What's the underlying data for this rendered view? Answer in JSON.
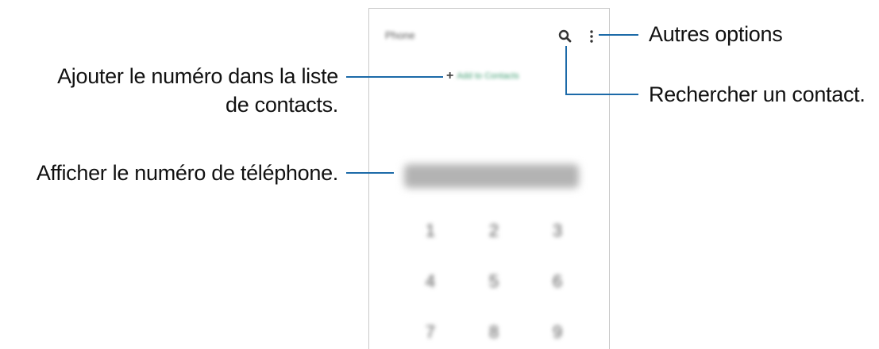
{
  "labels": {
    "more_options": "Autres options",
    "add_contact_line1": "Ajouter le numéro dans la liste",
    "add_contact_line2": "de contacts.",
    "search_contact": "Rechercher un contact.",
    "show_number": "Afficher le numéro de téléphone."
  },
  "phone": {
    "app_title": "Phone",
    "add_contact_label": "Add to Contacts",
    "add_contact_plus": "+",
    "keypad": [
      "1",
      "2",
      "3",
      "4",
      "5",
      "6",
      "7",
      "8",
      "9"
    ]
  },
  "icons": {
    "search": "search-icon",
    "more": "more-options-icon"
  },
  "colors": {
    "leader_line": "#1c6aa8",
    "accent": "#3a9b6e"
  }
}
